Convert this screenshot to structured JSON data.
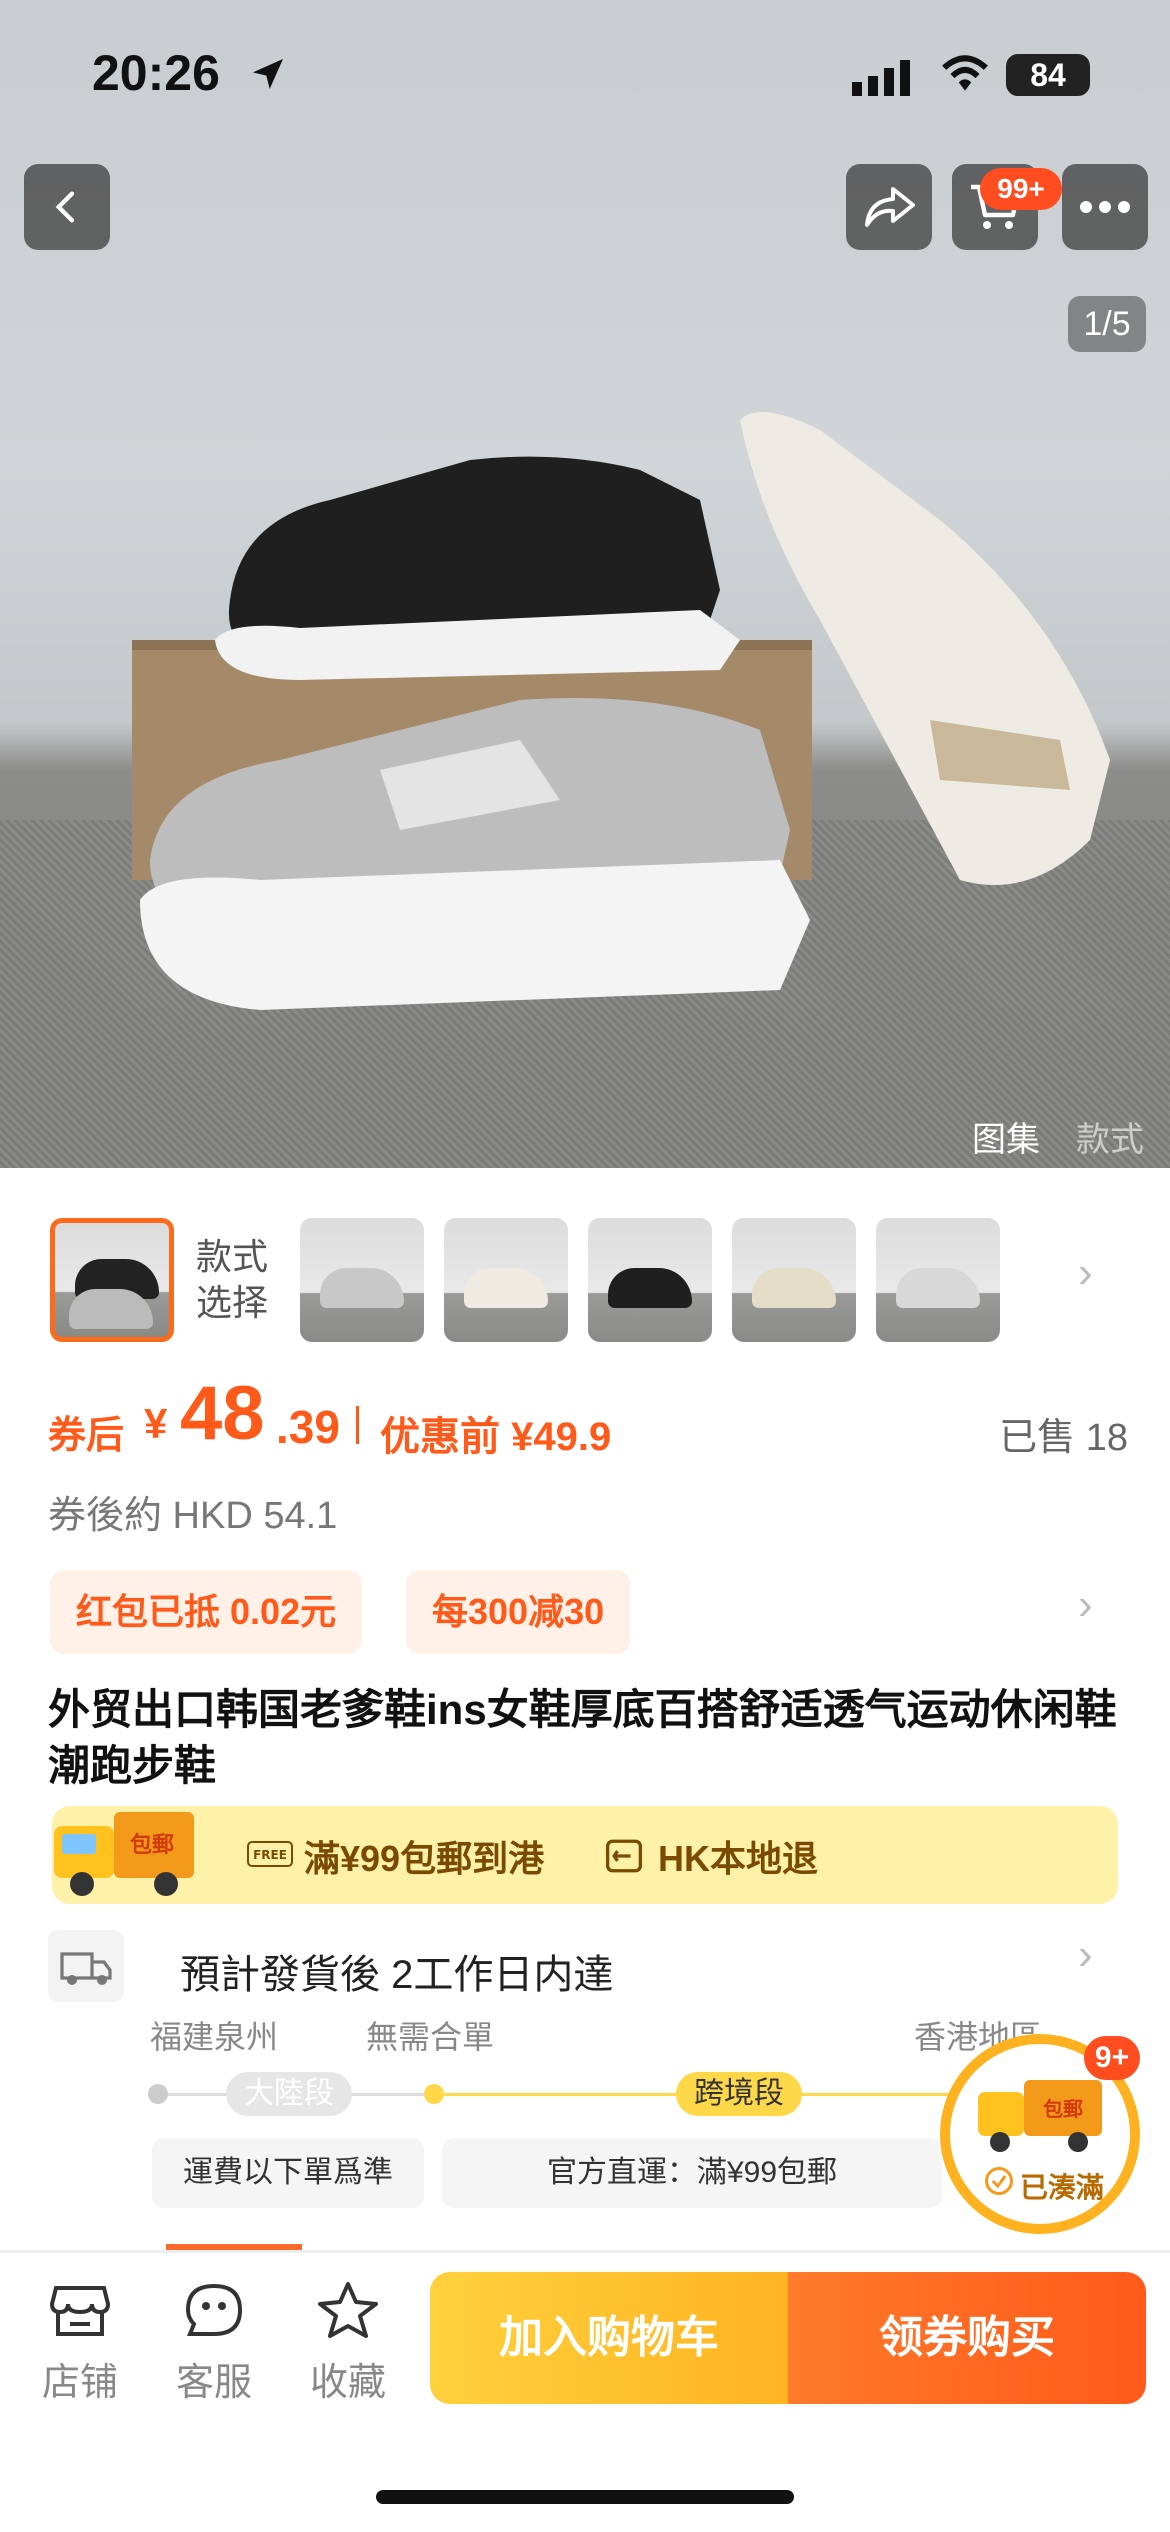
{
  "status_bar": {
    "time": "20:26",
    "battery": "84"
  },
  "header": {
    "cart_badge": "99+",
    "page_indicator": "1/5"
  },
  "hero_tabs": {
    "gallery": "图集",
    "style": "款式"
  },
  "thumbnails": {
    "style_label_1": "款式",
    "style_label_2": "选择"
  },
  "price": {
    "prefix": "券后",
    "currency": "¥",
    "integer": "48",
    "decimal": ".39",
    "before_label": "优惠前 ¥49.9",
    "sold": "已售 18",
    "hkd": "券後約 HKD 54.1"
  },
  "promos": {
    "red_packet": "红包已抵 0.02元",
    "discount": "每300减30"
  },
  "product": {
    "title": "外贸出口韩国老爹鞋ins女鞋厚底百搭舒适透气运动休闲鞋潮跑步鞋"
  },
  "shipping": {
    "truck_label": "包郵",
    "free_ship": "滿¥99包郵到港",
    "local_return": "HK本地退"
  },
  "eta": {
    "text": "預計發貨後 2工作日内達"
  },
  "route": {
    "origin": "福建泉州",
    "merge": "無需合單",
    "destination": "香港地區",
    "mainland": "大陸段",
    "cross_border": "跨境段",
    "fee_note": "運費以下單爲準",
    "official": "官方直運：滿¥99包郵"
  },
  "float_badge": {
    "count": "9+",
    "label": "包郵",
    "status": "已湊滿"
  },
  "bottom_bar": {
    "shop": "店铺",
    "service": "客服",
    "favorite": "收藏",
    "add_cart": "加入购物车",
    "buy": "领券购买"
  },
  "colors": {
    "accent": "#ff5a1a",
    "yellow": "#ffd13c",
    "banner": "#fff1a8"
  }
}
